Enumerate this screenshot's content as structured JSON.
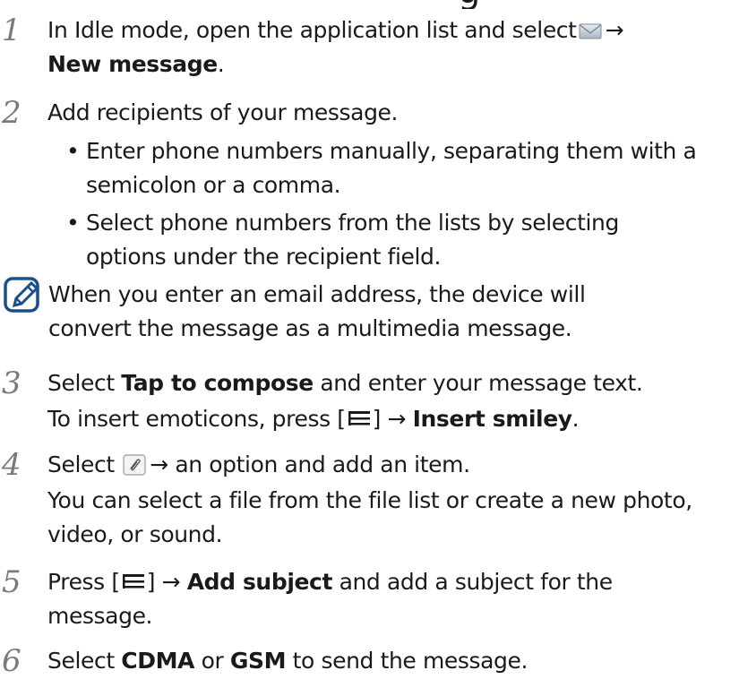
{
  "heading_fragment": "g",
  "icons": {
    "messaging": "envelope-icon",
    "menu_key": "menu-key-icon",
    "attach": "paperclip-icon",
    "note": "note-pencil-icon"
  },
  "colors": {
    "text": "#1a1a1a",
    "step_number": "#7a7a7a",
    "note_icon": "#1a4f8c"
  },
  "steps": [
    {
      "number": "1",
      "line1_a": "In Idle mode, open the application list and select",
      "line1_b": "→",
      "line2_bold": "New message",
      "line2_end": "."
    },
    {
      "number": "2",
      "text": "Add recipients of your message.",
      "bullets": [
        {
          "mark": "•",
          "line1": "Enter phone numbers manually, separating them with a",
          "line2": "semicolon or a comma."
        },
        {
          "mark": "•",
          "line1": "Select phone numbers from the lists by selecting",
          "line2": "options under the recipient field."
        }
      ],
      "note": {
        "line1": "When you enter an email address, the device will",
        "line2": "convert the message as a multimedia message."
      }
    },
    {
      "number": "3",
      "line1_a": "Select",
      "line1_bold": "Tap to compose",
      "line1_b": "and enter your message text.",
      "line2_a": "To insert emoticons, press [",
      "line2_b": "] →",
      "line2_bold": "Insert smiley",
      "line2_end": "."
    },
    {
      "number": "4",
      "line1_a": "Select",
      "line1_b": "→ an option and add an item.",
      "line2": "You can select a file from the file list or create a new photo,",
      "line3": "video, or sound."
    },
    {
      "number": "5",
      "line1_a": "Press [",
      "line1_b": "] →",
      "line1_bold": "Add subject",
      "line1_c": "and add a subject for the",
      "line2": "message."
    },
    {
      "number": "6",
      "line1_a": "Select",
      "line1_bold1": "CDMA",
      "line1_b": "or",
      "line1_bold2": "GSM",
      "line1_c": "to send the message."
    }
  ]
}
